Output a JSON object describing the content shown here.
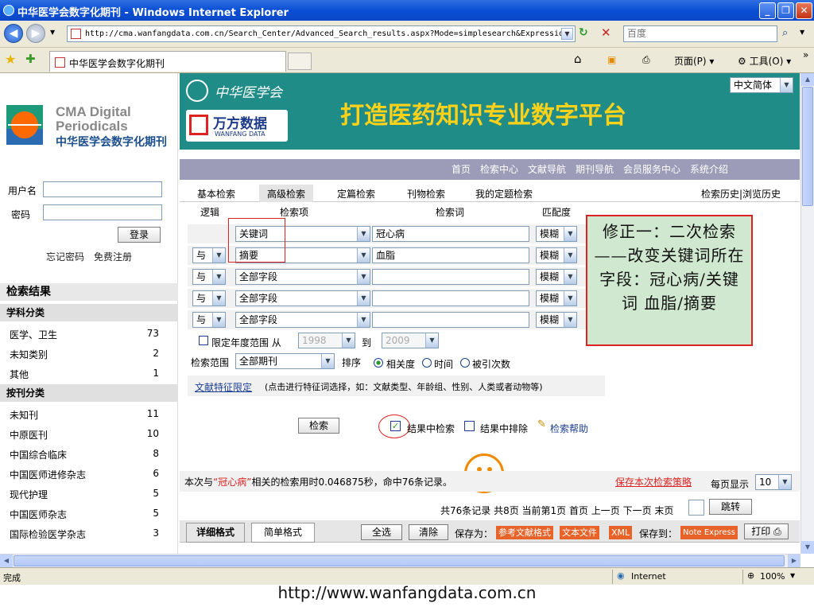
{
  "window": {
    "title": "中华医学会数字化期刊 - Windows Internet Explorer"
  },
  "browser": {
    "address": "http://cma.wanfangdata.com.cn/Search_Center/Advanced_Search_results.aspx?Mode=simplesearch&Expressio",
    "search_placeholder": "百度",
    "tab_title": "中华医学会数字化期刊",
    "toolbar": {
      "page": "页面(P)",
      "tools": "工具(O)"
    }
  },
  "sidebar": {
    "cma_title_line1": "CMA Digital",
    "cma_title_line2": "Periodicals",
    "cma_chinese": "中华医学会数字化期刊",
    "login": {
      "username_label": "用户名",
      "password_label": "密码",
      "login_button": "登录",
      "forgot": "忘记密码",
      "register": "免费注册"
    },
    "results_title": "检索结果",
    "subject_header": "学科分类",
    "subjects": [
      {
        "name": "医学、卫生",
        "count": "73"
      },
      {
        "name": "未知类别",
        "count": "2"
      },
      {
        "name": "其他",
        "count": "1"
      }
    ],
    "journal_header": "按刊分类",
    "journals": [
      {
        "name": "未知刊",
        "count": "11"
      },
      {
        "name": "中原医刊",
        "count": "10"
      },
      {
        "name": "中国综合临床",
        "count": "8"
      },
      {
        "name": "中国医师进修杂志",
        "count": "6"
      },
      {
        "name": "现代护理",
        "count": "5"
      },
      {
        "name": "中国医师杂志",
        "count": "5"
      },
      {
        "name": "国际检验医学杂志",
        "count": "3"
      }
    ]
  },
  "banner": {
    "org": "中华医学会",
    "wanfang_cn": "万方数据",
    "wanfang_en": "WANFANG DATA",
    "slogan": "打造医药知识专业数字平台",
    "lang": "中文简体"
  },
  "topnav": [
    "首页",
    "检索中心",
    "文献导航",
    "期刊导航",
    "会员服务中心",
    "系统介绍"
  ],
  "search_tabs": [
    "基本检索",
    "高级检索",
    "定篇检索",
    "刊物检索",
    "我的定题检索"
  ],
  "history_links": "检索历史|浏览历史",
  "form": {
    "col_logic": "逻辑",
    "col_field": "检索项",
    "col_term": "检索词",
    "col_match": "匹配度",
    "rows": [
      {
        "logic": "",
        "field": "关键词",
        "term": "冠心病",
        "match": "模糊"
      },
      {
        "logic": "与",
        "field": "摘要",
        "term": "血脂",
        "match": "模糊"
      },
      {
        "logic": "与",
        "field": "全部字段",
        "term": "",
        "match": "模糊"
      },
      {
        "logic": "与",
        "field": "全部字段",
        "term": "",
        "match": "模糊"
      },
      {
        "logic": "与",
        "field": "全部字段",
        "term": "",
        "match": "模糊"
      }
    ],
    "year_limit_label": "限定年度范围 从",
    "year_from": "1998",
    "year_to_label": "到",
    "year_to": "2009",
    "scope_label": "检索范围",
    "scope_value": "全部期刊",
    "sort_label": "排序",
    "sort_options": [
      "相关度",
      "时间",
      "被引次数"
    ],
    "feature_link": "文献特征限定",
    "feature_hint": "(点击进行特征词选择，如：文献类型、年龄组、性别、人类或者动物等)",
    "search_button": "检索",
    "within_results": "结果中检索",
    "exclude_results": "结果中排除",
    "help": "检索帮助"
  },
  "annotation": {
    "text": "修正一：二次检索——改变关键词所在字段：冠心病/关键词 血脂/摘要"
  },
  "result_summary": {
    "prefix": "本次与",
    "keyword": "“冠心病”",
    "suffix": "相关的检索用时0.046875秒，命中76条记录。",
    "save_link": "保存本次检索策略",
    "per_page_label": "每页显示",
    "per_page": "10"
  },
  "pager": {
    "text": "共76条记录 共8页 当前第1页 首页 上一页  下一页 末页",
    "jump": "跳转"
  },
  "result_toolbar": {
    "detail_tab": "详细格式",
    "brief_tab": "简单格式",
    "select_all": "全选",
    "clear": "清除",
    "save_as": "保存为：",
    "ref_format": "参考文献格式",
    "text_file": "文本文件",
    "xml": "XML",
    "save_to": "保存到：",
    "note_express": "Note Express",
    "print": "打印"
  },
  "status": {
    "left": "完成",
    "zone": "Internet",
    "zoom": "100%"
  },
  "footer_url": "http://www.wanfangdata.com.cn"
}
